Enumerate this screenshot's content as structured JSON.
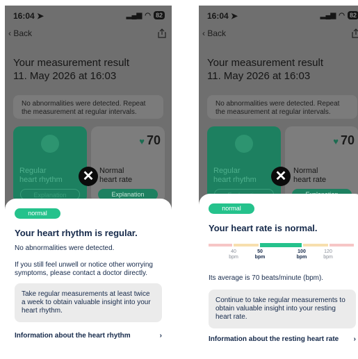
{
  "status": {
    "time": "16:04",
    "battery": "82"
  },
  "nav": {
    "back_label": "Back"
  },
  "result": {
    "title": "Your measurement result",
    "datetime": "11. May 2026 at 16:03",
    "note": "No abnormalities were detected. Repeat the measurement at regular intervals."
  },
  "cards": {
    "rhythm": {
      "line1": "Regular",
      "line2": "heart rhythm",
      "button": "Explanation"
    },
    "rate": {
      "value": "70",
      "line1": "Normal",
      "line2": "heart rate",
      "button": "Explanation"
    }
  },
  "sheet_rhythm": {
    "badge": "normal",
    "heading": "Your heart rhythm is regular.",
    "text1": "No abnormalities were detected.",
    "text2": "If you still feel unwell or notice other worrying symptoms, please contact a doctor directly.",
    "tip": "Take regular measurements at least twice a week to obtain valuable insight into your heart rhythm.",
    "link": "Information about the heart rhythm"
  },
  "sheet_rate": {
    "badge": "normal",
    "heading": "Your heart rate is normal.",
    "scale": {
      "ticks": [
        {
          "value": "40",
          "unit": "bpm"
        },
        {
          "value": "50",
          "unit": "bpm"
        },
        {
          "value": "100",
          "unit": "bpm"
        },
        {
          "value": "120",
          "unit": "bpm"
        }
      ],
      "segment_colors": [
        "#f6c6c6",
        "#f7dfae",
        "#25c28c",
        "#f7dfae",
        "#f6c6c6"
      ]
    },
    "average": "Its average is 70 beats/minute (bpm).",
    "tip": "Continue to take regular measurements to obtain valuable insight into your resting heart rate.",
    "link": "Information about the resting heart rate"
  },
  "colors": {
    "accent": "#25c28c",
    "card_green": "#1d8060",
    "text_dark": "#15294a"
  }
}
